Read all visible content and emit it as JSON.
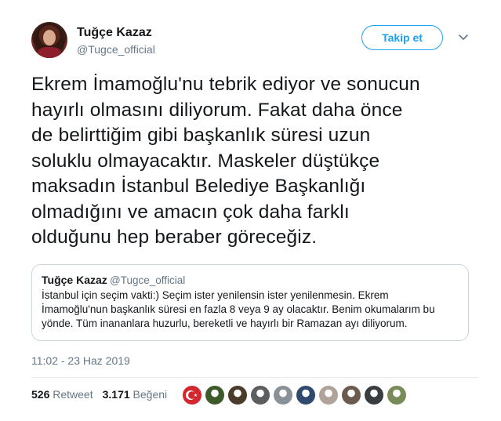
{
  "user": {
    "name": "Tuğçe Kazaz",
    "handle": "@Tugce_official"
  },
  "follow_label": "Takip et",
  "tweet_lines": [
    "Ekrem İmamoğlu'nu tebrik ediyor ve sonucun",
    "hayırlı olmasını diliyorum. Fakat daha önce",
    "de belirttiğim gibi başkanlık süresi uzun",
    "soluklu olmayacaktır. Maskeler düştükçe",
    "maksadın İstanbul Belediye Başkanlığı",
    "olmadığını ve amacın çok daha farklı",
    "olduğunu hep beraber göreceğiz."
  ],
  "quote": {
    "name": "Tuğçe Kazaz",
    "handle": "@Tugce_official",
    "lines": [
      "İstanbul için seçim vakti:) Seçim ister yenilensin ister yenilenmesin. Ekrem",
      "İmamoğlu'nun başkanlık süresi en fazla 8 veya 9 ay olacaktır. Benim okumalarım bu",
      "yönde. Tüm inananlara huzurlu, bereketli ve hayırlı bir Ramazan ayı diliyorum."
    ]
  },
  "timestamp": "11:02 - 23 Haz 2019",
  "stats": {
    "retweet_count": "526",
    "retweet_label": "Retweet",
    "like_count": "3.171",
    "like_label": "Beğeni"
  },
  "likers": [
    {
      "icon": "turkish-flag-avatar",
      "color": "#d4262e"
    },
    {
      "icon": "avatar",
      "color": "#3d5a2a"
    },
    {
      "icon": "avatar",
      "color": "#4a3b2b"
    },
    {
      "icon": "avatar",
      "color": "#5c5e60"
    },
    {
      "icon": "avatar",
      "color": "#8a9199"
    },
    {
      "icon": "avatar",
      "color": "#2f4a6e"
    },
    {
      "icon": "avatar",
      "color": "#b0a49a"
    },
    {
      "icon": "avatar",
      "color": "#6b5a4e"
    },
    {
      "icon": "avatar",
      "color": "#3a3d40"
    },
    {
      "icon": "avatar",
      "color": "#7a8b5a"
    }
  ],
  "colors": {
    "accent": "#1da1f2",
    "secondary_text": "#657786",
    "border": "#ccd6dd"
  }
}
